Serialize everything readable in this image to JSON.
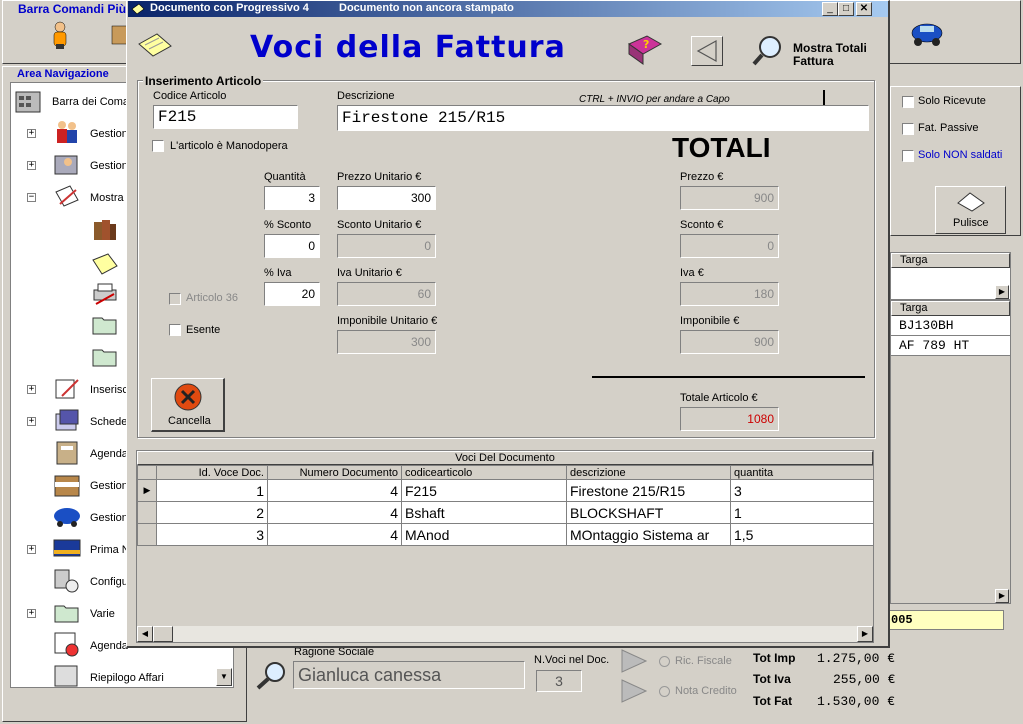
{
  "bg": {
    "toolbar_title": "Barra Comandi Più",
    "nav_title": "Area Navigazione",
    "tree": [
      {
        "label": "Barra dei Comandi"
      },
      {
        "label": "Gestione"
      },
      {
        "label": "Gestione"
      },
      {
        "label": "Mostra"
      },
      {
        "label": "Inserisci"
      },
      {
        "label": "Schede"
      },
      {
        "label": "Agenda"
      },
      {
        "label": "Gestione"
      },
      {
        "label": "Gestione"
      },
      {
        "label": "Prima N"
      },
      {
        "label": "Configu"
      },
      {
        "label": "Varie"
      },
      {
        "label": "Agenda"
      },
      {
        "label": "Riepilogo Affari"
      }
    ],
    "filters": {
      "solo_ricevute": "Solo Ricevute",
      "fat_passive": "Fat. Passive",
      "solo_non_saldati": "Solo NON saldati"
    },
    "pulisce": "Pulisce",
    "targa_header1": "Targa",
    "targa_header2": "Targa",
    "targa_rows": [
      "BJ130BH",
      "AF 789 HT"
    ],
    "year_fragment": "005",
    "ragione_sociale_label": "Ragione Sociale",
    "ragione_sociale_value": "Gianluca canessa",
    "nvoci_label": "N.Voci nel Doc.",
    "nvoci_value": "3",
    "ric_fiscale": "Ric. Fiscale",
    "nota_credito": "Nota Credito",
    "totals": [
      {
        "label": "Tot Imp",
        "value": "1.275,00 €"
      },
      {
        "label": "Tot Iva",
        "value": "255,00 €"
      },
      {
        "label": "Tot Fat",
        "value": "1.530,00 €"
      }
    ]
  },
  "dialog": {
    "title": "Documento con Progressivo 4",
    "status": "Documento non ancora stampato",
    "heading": "Voci della Fattura",
    "mostra_totali": "Mostra Totali Fattura",
    "group_title": "Inserimento Articolo",
    "codice_label": "Codice Articolo",
    "codice_value": "F215",
    "descr_label": "Descrizione",
    "descr_value": "Firestone 215/R15",
    "ctrl_hint": "CTRL + INVIO per andare a Capo",
    "manodopera": "L'articolo è Manodopera",
    "totali": "TOTALI",
    "quantita_label": "Quantità",
    "quantita_value": "3",
    "prezzo_unit_label": "Prezzo Unitario €",
    "prezzo_unit_value": "300",
    "sconto_label": "% Sconto",
    "sconto_value": "0",
    "sconto_unit_label": "Sconto Unitario €",
    "sconto_unit_value": "0",
    "iva_label": "% Iva",
    "iva_value": "20",
    "iva_unit_label": "Iva Unitario €",
    "iva_unit_value": "60",
    "impon_unit_label": "Imponibile Unitario €",
    "impon_unit_value": "300",
    "articolo36": "Articolo 36",
    "esente": "Esente",
    "prezzo_tot_label": "Prezzo €",
    "prezzo_tot_value": "900",
    "sconto_tot_label": "Sconto €",
    "sconto_tot_value": "0",
    "iva_tot_label": "Iva €",
    "iva_tot_value": "180",
    "impon_tot_label": "Imponibile €",
    "impon_tot_value": "900",
    "totale_art_label": "Totale Articolo €",
    "totale_art_value": "1080",
    "cancella": "Cancella",
    "grid_title": "Voci Del Documento",
    "columns": [
      "Id. Voce Doc.",
      "Numero Documento",
      "codicearticolo",
      "descrizione",
      "quantita"
    ],
    "rows": [
      [
        "1",
        "4",
        "F215",
        "Firestone 215/R15",
        "3"
      ],
      [
        "2",
        "4",
        "Bshaft",
        "BLOCKSHAFT",
        "1"
      ],
      [
        "3",
        "4",
        "MAnod",
        "MOntaggio Sistema ar",
        "1,5"
      ]
    ]
  },
  "colors": {
    "title_blue": "#0000cc",
    "total_red": "#cc0000",
    "link_blue": "#0000cc"
  }
}
